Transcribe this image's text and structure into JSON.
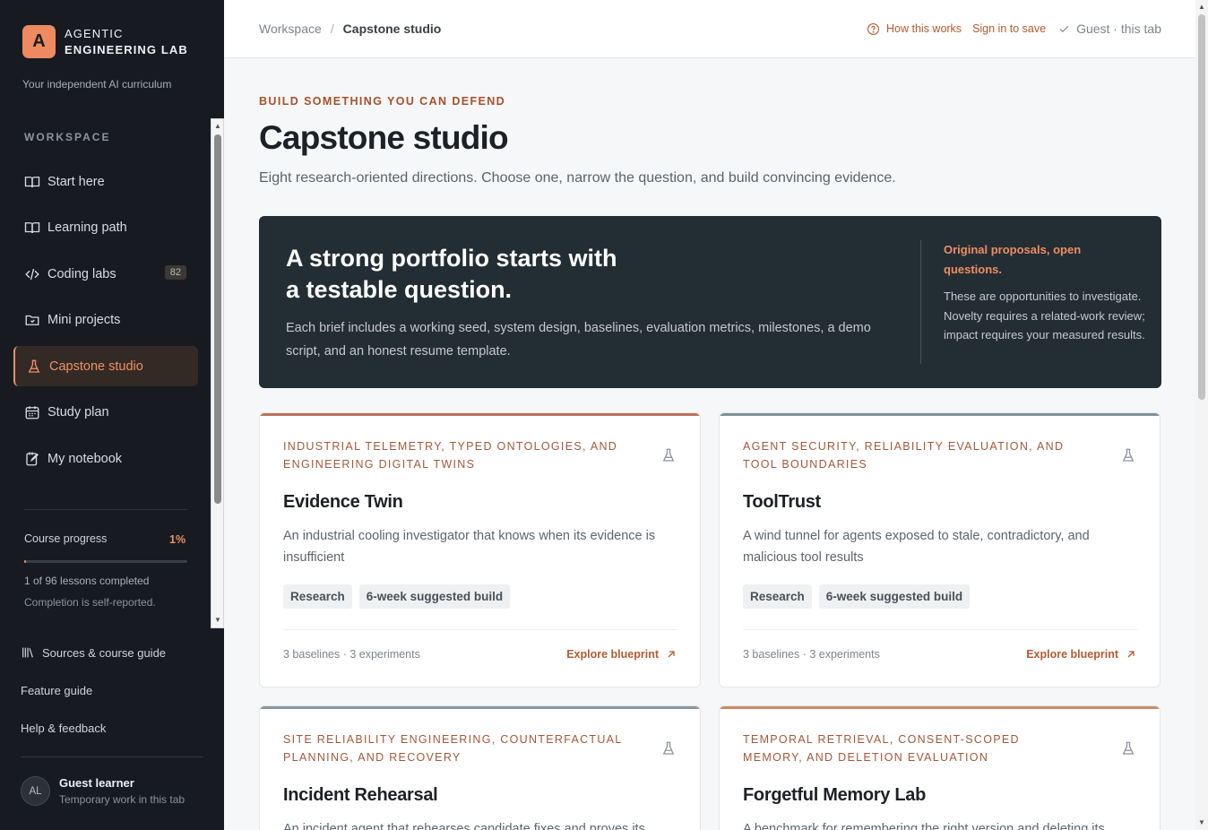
{
  "brand": {
    "logo_letter": "A",
    "line1": "AGENTIC",
    "line2": "ENGINEERING LAB",
    "tagline": "Your independent AI curriculum"
  },
  "sidebar": {
    "section_label": "WORKSPACE",
    "items": [
      {
        "label": "Start here",
        "icon": "book-open-icon"
      },
      {
        "label": "Learning path",
        "icon": "book-open-icon"
      },
      {
        "label": "Coding labs",
        "icon": "code-icon",
        "badge": "82"
      },
      {
        "label": "Mini projects",
        "icon": "folder-icon"
      },
      {
        "label": "Capstone studio",
        "icon": "flask-icon",
        "active": true
      },
      {
        "label": "Study plan",
        "icon": "calendar-icon"
      },
      {
        "label": "My notebook",
        "icon": "notebook-edit-icon"
      }
    ],
    "progress": {
      "label": "Course progress",
      "percent_text": "1%",
      "fraction": 0.01,
      "lessons_text": "1 of 96 lessons completed",
      "note": "Completion is self-reported."
    },
    "links": {
      "sources": "Sources & course guide",
      "feature_guide": "Feature guide",
      "help": "Help & feedback"
    },
    "user": {
      "initials": "AL",
      "name": "Guest learner",
      "sub": "Temporary work in this tab"
    }
  },
  "topbar": {
    "breadcrumb_root": "Workspace",
    "breadcrumb_sep": "/",
    "breadcrumb_current": "Capstone studio",
    "how": "How this works",
    "signin": "Sign in to save",
    "guest": "Guest · this tab"
  },
  "page": {
    "eyebrow": "BUILD SOMETHING YOU CAN DEFEND",
    "title": "Capstone studio",
    "subtitle": "Eight research-oriented directions. Choose one, narrow the question, and build convincing evidence."
  },
  "hero": {
    "title": "A strong portfolio starts with a testable question.",
    "text": "Each brief includes a working seed, system design, baselines, evaluation metrics, milestones, a demo script, and an honest resume template.",
    "side_title": "Original proposals, open questions.",
    "side_text": "These are opportunities to investigate. Novelty requires a related-work review; impact requires your measured results."
  },
  "cards": [
    {
      "topic": "INDUSTRIAL TELEMETRY, TYPED ONTOLOGIES, AND ENGINEERING DIGITAL TWINS",
      "title": "Evidence Twin",
      "desc": "An industrial cooling investigator that knows when its evidence is insufficient",
      "tags": [
        "Research",
        "6-week suggested build"
      ],
      "meta": "3 baselines · 3 experiments",
      "cta": "Explore blueprint",
      "accent": "#b9735a"
    },
    {
      "topic": "AGENT SECURITY, RELIABILITY EVALUATION, AND TOOL BOUNDARIES",
      "title": "ToolTrust",
      "desc": "A wind tunnel for agents exposed to stale, contradictory, and malicious tool results",
      "tags": [
        "Research",
        "6-week suggested build"
      ],
      "meta": "3 baselines · 3 experiments",
      "cta": "Explore blueprint",
      "accent": "#7f9497"
    },
    {
      "topic": "SITE RELIABILITY ENGINEERING, COUNTERFACTUAL PLANNING, AND RECOVERY",
      "title": "Incident Rehearsal",
      "desc": "An incident agent that rehearses candidate fixes and proves its rollback",
      "accent": "#8796a3"
    },
    {
      "topic": "TEMPORAL RETRIEVAL, CONSENT-SCOPED MEMORY, AND DELETION EVALUATION",
      "title": "Forgetful Memory Lab",
      "desc": "A benchmark for remembering the right version and deleting its",
      "accent": "#c98a67"
    }
  ]
}
